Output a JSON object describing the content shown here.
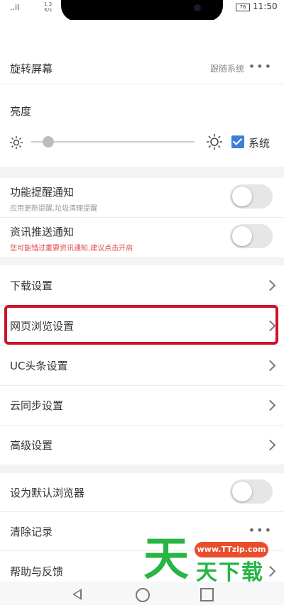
{
  "status_bar": {
    "signal": "..il",
    "speed": "1.3\nK/s",
    "battery": "76",
    "time": "11:50"
  },
  "display": {
    "rotate": {
      "label": "旋转屏幕",
      "value": "跟随系统"
    },
    "brightness": {
      "label": "亮度",
      "level": 0.07,
      "system_label": "系统",
      "system_checked": true
    }
  },
  "notifications": [
    {
      "label": "功能提醒通知",
      "subtitle": "应用更新提醒,垃圾清理提醒",
      "enabled": false
    },
    {
      "label": "资讯推送通知",
      "subtitle": "您可能错过重要资讯通知,建议点击开启",
      "enabled": false
    }
  ],
  "settings_menu": [
    {
      "label": "下载设置"
    },
    {
      "label": "网页浏览设置"
    },
    {
      "label": "UC头条设置"
    },
    {
      "label": "云同步设置"
    },
    {
      "label": "高级设置"
    }
  ],
  "misc": {
    "default_browser": {
      "label": "设为默认浏览器",
      "enabled": false
    },
    "clear_records": {
      "label": "清除记录"
    },
    "help": {
      "label": "帮助与反馈"
    }
  },
  "watermark": {
    "url": "www.TTzip.com",
    "big_char": "天",
    "text": "天下载"
  },
  "colors": {
    "highlight": "#d0122c",
    "checkbox": "#3d7fd6",
    "warning_text": "#e04a4a",
    "watermark_green": "#27b544",
    "watermark_orange": "#e94e2b"
  },
  "icons": [
    "sun-small-icon",
    "sun-large-icon",
    "chevron-right-icon",
    "more-dots-icon",
    "back-icon",
    "home-icon",
    "recent-apps-icon"
  ]
}
